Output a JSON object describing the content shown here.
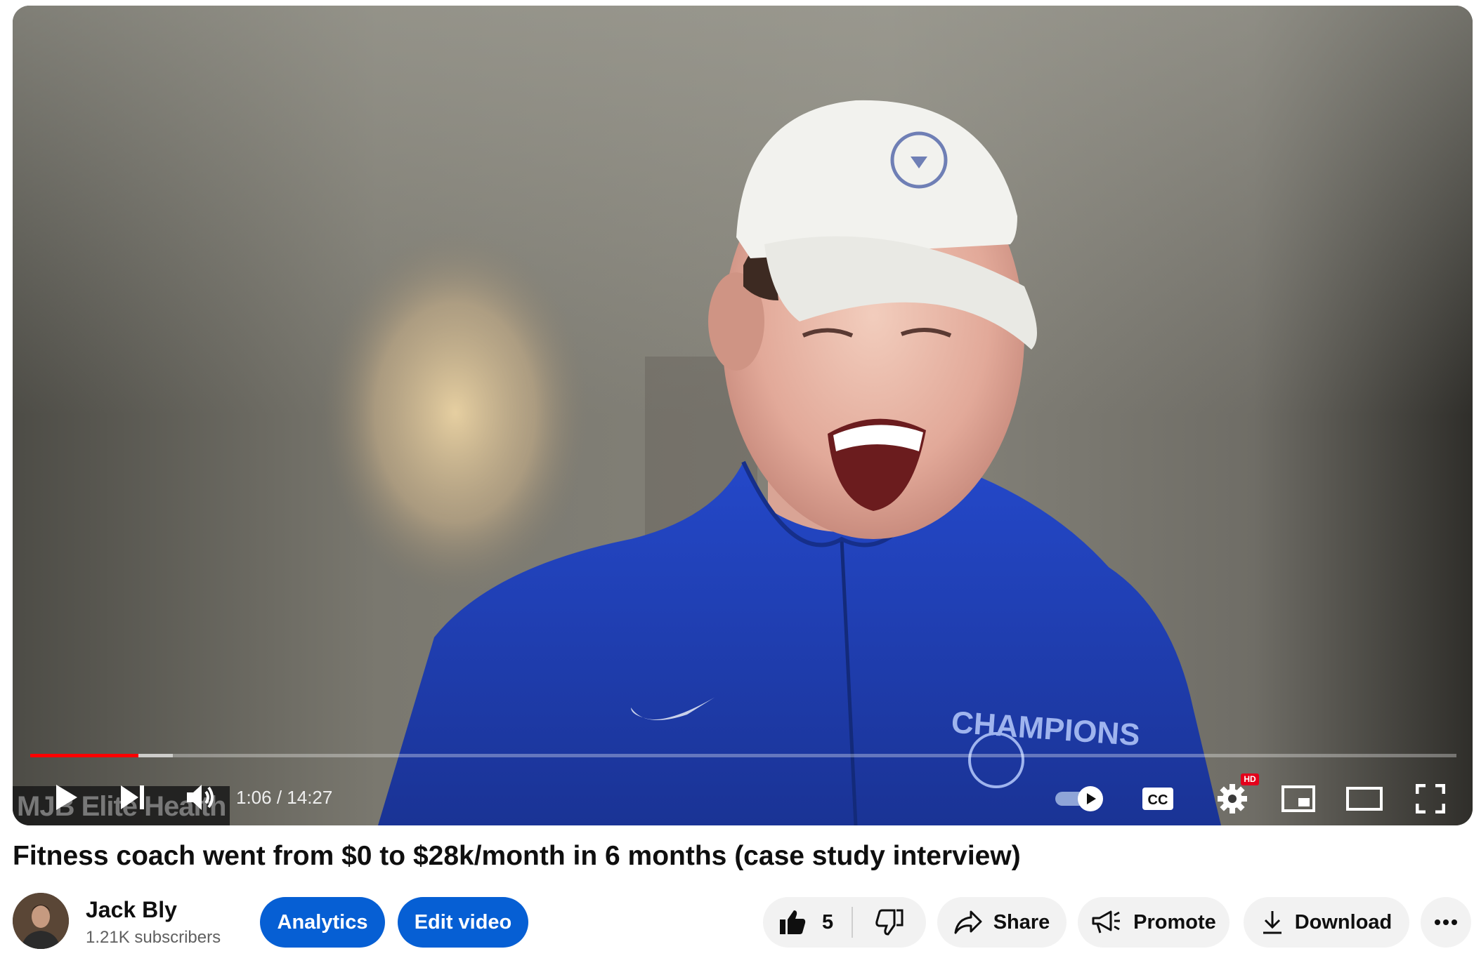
{
  "player": {
    "watermark": "MJB Elite Health",
    "current_time": "1:06",
    "duration": "14:27",
    "time_separator": " / ",
    "progress_played_fraction": 0.076,
    "progress_buffered_fraction": 0.1,
    "quality_badge": "HD",
    "autoplay_on": true
  },
  "video": {
    "title": "Fitness coach went from $0 to $28k/month in 6 months (case study interview)"
  },
  "channel": {
    "name": "Jack Bly",
    "subscribers": "1.21K subscribers"
  },
  "actions": {
    "analytics_label": "Analytics",
    "edit_label": "Edit video",
    "like_count": "5",
    "share_label": "Share",
    "promote_label": "Promote",
    "download_label": "Download"
  },
  "colors": {
    "accent_blue": "#065fd4",
    "progress_red": "#ff0000",
    "button_gray": "#f2f2f2"
  }
}
